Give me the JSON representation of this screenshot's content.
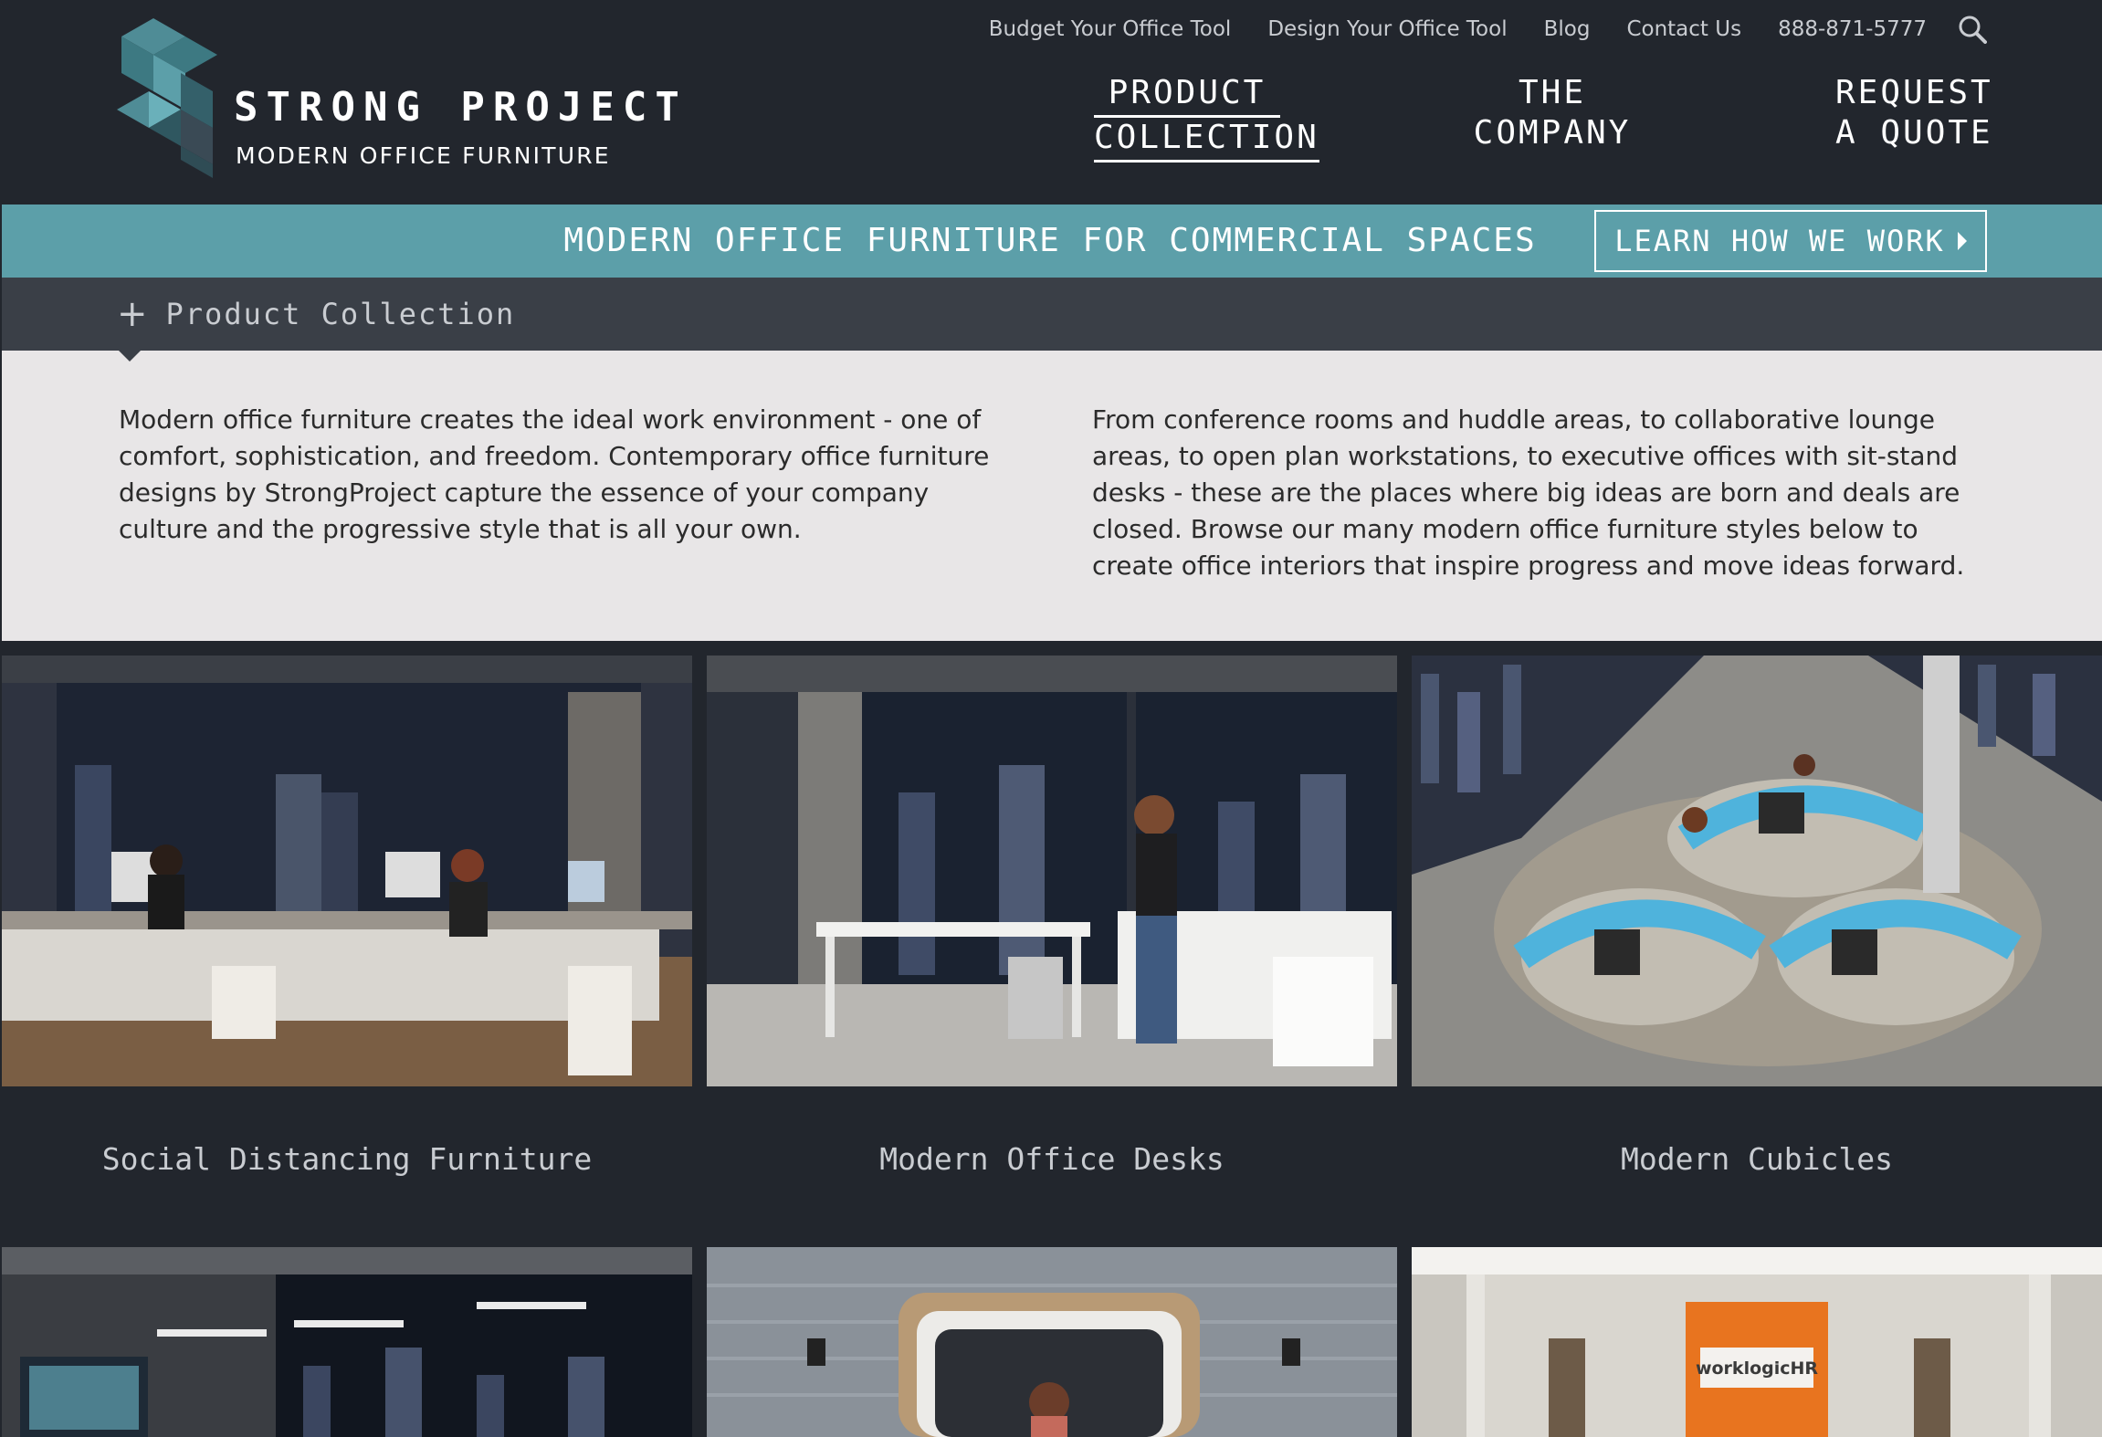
{
  "brand": {
    "name": "STRONG PROJECT",
    "tagline": "MODERN OFFICE FURNITURE",
    "colors": {
      "background": "#22262d",
      "accent": "#5c9fa9",
      "bar": "#3a3f47",
      "intro_bg": "#e8e6e7"
    }
  },
  "utility_nav": {
    "budget": "Budget Your Office Tool",
    "design": "Design Your Office Tool",
    "blog": "Blog",
    "contact": "Contact Us",
    "phone": "888-871-5777",
    "search_icon": "search-icon"
  },
  "main_nav": {
    "product": [
      "PRODUCT",
      "COLLECTION"
    ],
    "company": [
      "THE",
      "COMPANY"
    ],
    "quote": [
      "REQUEST",
      "A QUOTE"
    ]
  },
  "banner": {
    "text": "MODERN OFFICE FURNITURE FOR COMMERCIAL SPACES",
    "button": "LEARN HOW WE WORK"
  },
  "collection_bar": {
    "label": "Product Collection",
    "icon": "plus-icon"
  },
  "intro": {
    "col1": "Modern office furniture creates the ideal work environment - one of comfort, sophistication, and freedom. Contemporary office furniture designs by StrongProject capture the essence of your company culture and the progressive style that is all your own.",
    "col2": "From conference rooms and huddle areas, to collaborative lounge areas, to open plan workstations, to executive offices with sit-stand desks - these are the places where big ideas are born and deals are closed. Browse our many modern office furniture styles below to create office interiors that inspire progress and move ideas forward."
  },
  "products": [
    {
      "title": "Social Distancing Furniture"
    },
    {
      "title": "Modern Office Desks"
    },
    {
      "title": "Modern Cubicles"
    }
  ],
  "products_row2": {
    "sign_text": "worklogicHR"
  }
}
